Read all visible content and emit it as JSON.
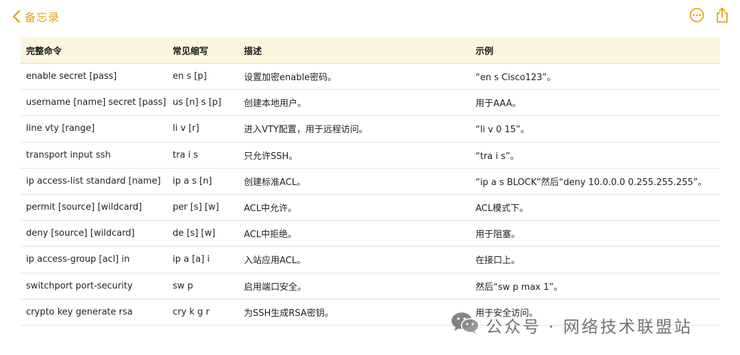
{
  "nav": {
    "back_label": "备忘录",
    "accent_color": "#E3A40C",
    "icons": [
      "chevron-left-icon",
      "more-circle-icon",
      "share-icon"
    ]
  },
  "table": {
    "headers": [
      "完整命令",
      "常见缩写",
      "描述",
      "示例"
    ],
    "rows": [
      [
        "enable secret [pass]",
        "en s [p]",
        "设置加密enable密码。",
        "“en s Cisco123”。"
      ],
      [
        "username [name] secret [pass]",
        "us [n] s [p]",
        "创建本地用户。",
        "用于AAA。"
      ],
      [
        "line vty [range]",
        "li v [r]",
        "进入VTY配置，用于远程访问。",
        "“li v 0 15”。"
      ],
      [
        "transport input ssh",
        "tra i s",
        "只允许SSH。",
        "“tra i s”。"
      ],
      [
        "ip access-list standard [name]",
        "ip a s [n]",
        "创建标准ACL。",
        "“ip a s BLOCK”然后“deny 10.0.0.0 0.255.255.255”。"
      ],
      [
        "permit [source] [wildcard]",
        "per [s] [w]",
        "ACL中允许。",
        "ACL模式下。"
      ],
      [
        "deny [source] [wildcard]",
        "de [s] [w]",
        "ACL中拒绝。",
        "用于阻塞。"
      ],
      [
        "ip access-group [acl] in",
        "ip a [a] i",
        "入站应用ACL。",
        "在接口上。"
      ],
      [
        "switchport port-security",
        "sw p",
        "启用端口安全。",
        "然后“sw p max 1”。"
      ],
      [
        "crypto key generate rsa",
        "cry k g r",
        "为SSH生成RSA密钥。",
        "用于安全访问。"
      ]
    ]
  },
  "watermark": {
    "text": "公众号 · 网络技术联盟站",
    "icon": "wechat-icon"
  }
}
